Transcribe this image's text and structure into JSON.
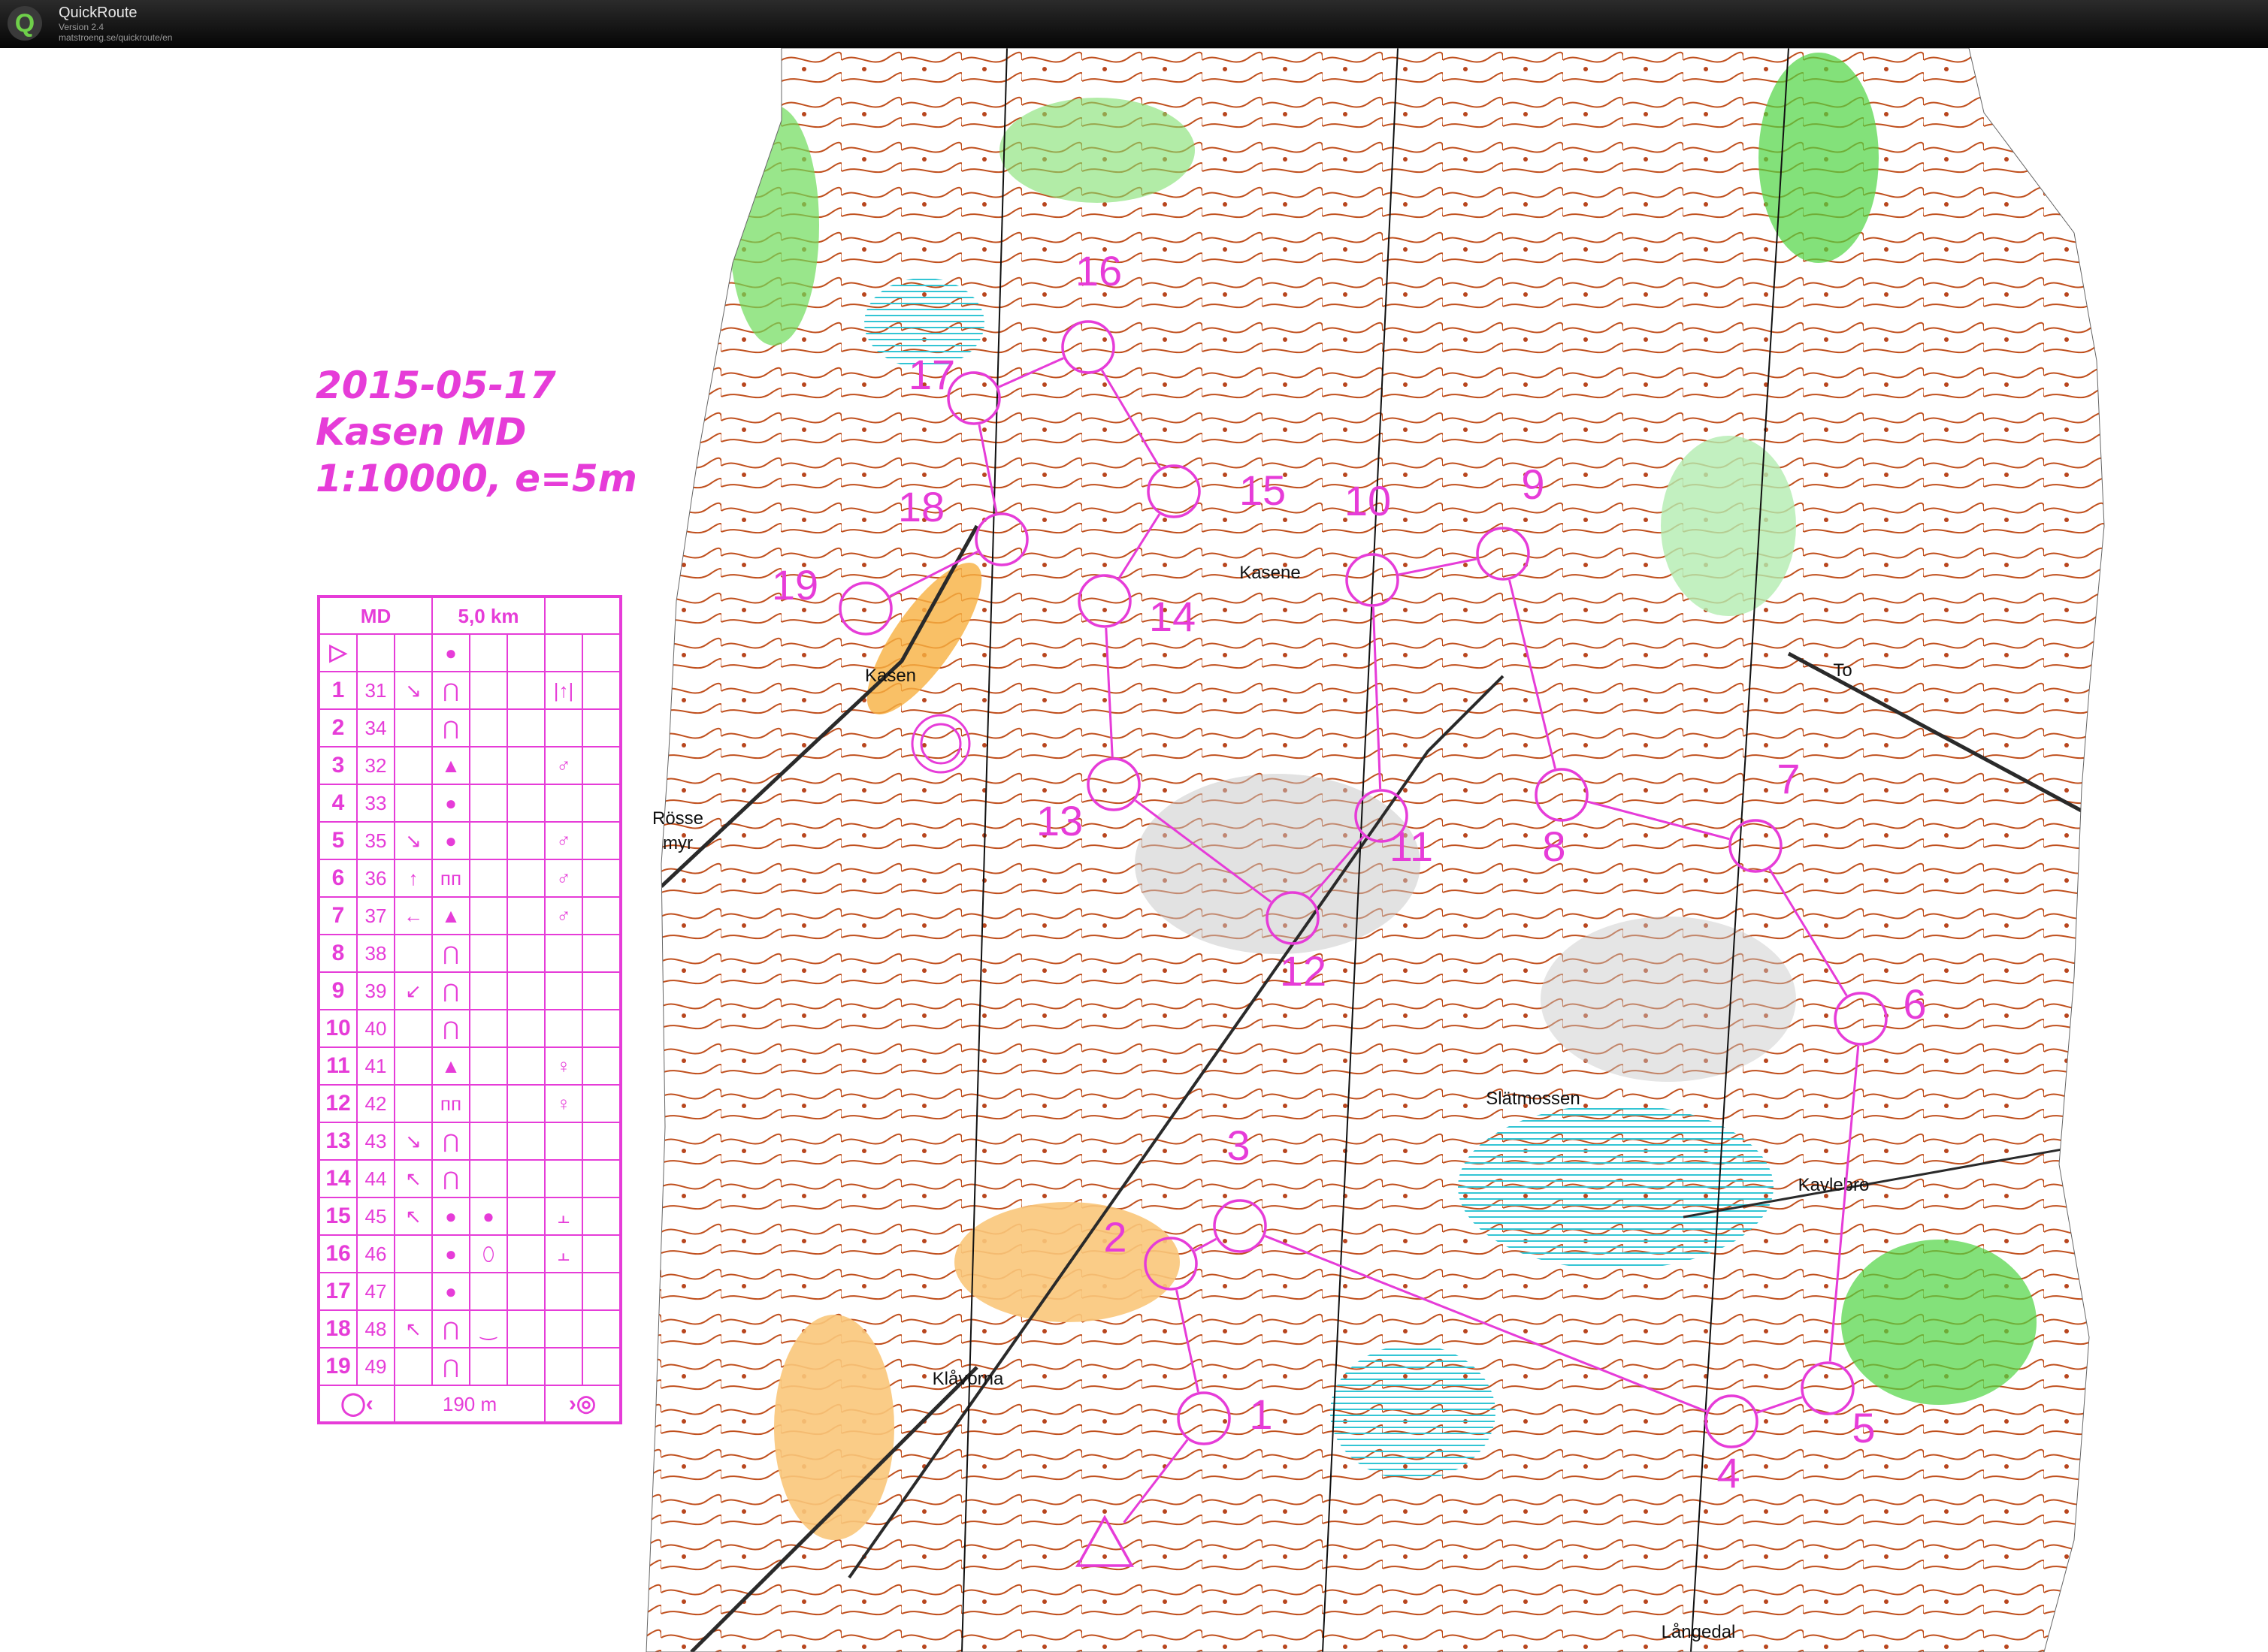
{
  "app": {
    "name": "QuickRoute",
    "version": "Version 2.4",
    "url": "matstroeng.se/quickroute/en",
    "logo_letter": "Q"
  },
  "map": {
    "place_names": [
      "Kasene",
      "Kasen",
      "Rösse",
      "myr",
      "To",
      "Slätmossen",
      "Kavlebro",
      "Klåvorna",
      "Långedal"
    ]
  },
  "course_meta": {
    "date": "2015-05-17",
    "event": "Kasen MD",
    "scale": "1:10000, e=5m"
  },
  "description": {
    "class": "MD",
    "length": "5,0 km",
    "rows": [
      {
        "num": "",
        "code": "",
        "dir": "",
        "feature": "●",
        "detail": "",
        "pos": ""
      },
      {
        "num": "1",
        "code": "31",
        "dir": "↘",
        "feature": "⋂",
        "detail": "",
        "pos": "|↑|"
      },
      {
        "num": "2",
        "code": "34",
        "dir": "",
        "feature": "⋂",
        "detail": "",
        "pos": ""
      },
      {
        "num": "3",
        "code": "32",
        "dir": "",
        "feature": "▲",
        "detail": "",
        "pos": "♂"
      },
      {
        "num": "4",
        "code": "33",
        "dir": "",
        "feature": "●",
        "detail": "",
        "pos": ""
      },
      {
        "num": "5",
        "code": "35",
        "dir": "↘",
        "feature": "●",
        "detail": "",
        "pos": "♂"
      },
      {
        "num": "6",
        "code": "36",
        "dir": "↑",
        "feature": "ᴨᴨ",
        "detail": "",
        "pos": "♂"
      },
      {
        "num": "7",
        "code": "37",
        "dir": "←",
        "feature": "▲",
        "detail": "",
        "pos": "♂"
      },
      {
        "num": "8",
        "code": "38",
        "dir": "",
        "feature": "⋂",
        "detail": "",
        "pos": ""
      },
      {
        "num": "9",
        "code": "39",
        "dir": "↙",
        "feature": "⋂",
        "detail": "",
        "pos": ""
      },
      {
        "num": "10",
        "code": "40",
        "dir": "",
        "feature": "⋂",
        "detail": "",
        "pos": ""
      },
      {
        "num": "11",
        "code": "41",
        "dir": "",
        "feature": "▲",
        "detail": "",
        "pos": "♀"
      },
      {
        "num": "12",
        "code": "42",
        "dir": "",
        "feature": "ᴨᴨ",
        "detail": "",
        "pos": "♀"
      },
      {
        "num": "13",
        "code": "43",
        "dir": "↘",
        "feature": "⋂",
        "detail": "",
        "pos": ""
      },
      {
        "num": "14",
        "code": "44",
        "dir": "↖",
        "feature": "⋂",
        "detail": "",
        "pos": ""
      },
      {
        "num": "15",
        "code": "45",
        "dir": "↖",
        "feature": "●",
        "detail": "●",
        "pos": "⫠"
      },
      {
        "num": "16",
        "code": "46",
        "dir": "",
        "feature": "●",
        "detail": "⬯",
        "pos": "⫠"
      },
      {
        "num": "17",
        "code": "47",
        "dir": "",
        "feature": "●",
        "detail": "",
        "pos": ""
      },
      {
        "num": "18",
        "code": "48",
        "dir": "↖",
        "feature": "⋂",
        "detail": "‿",
        "pos": ""
      },
      {
        "num": "19",
        "code": "49",
        "dir": "",
        "feature": "⋂",
        "detail": "",
        "pos": ""
      }
    ],
    "finish": {
      "distance": "190 m"
    }
  },
  "course": {
    "controls": [
      "1",
      "2",
      "3",
      "4",
      "5",
      "6",
      "7",
      "8",
      "9",
      "10",
      "11",
      "12",
      "13",
      "14",
      "15",
      "16",
      "17",
      "18",
      "19"
    ]
  },
  "colors": {
    "course": "#e63cd8",
    "contour": "#b8461e",
    "green": "#4fd441",
    "light_green": "#b3ecb0",
    "yellow": "#f9c77a",
    "water": "#33c5d4",
    "rock": "#9c9c9c",
    "titlebar": "#0d0d0d"
  }
}
